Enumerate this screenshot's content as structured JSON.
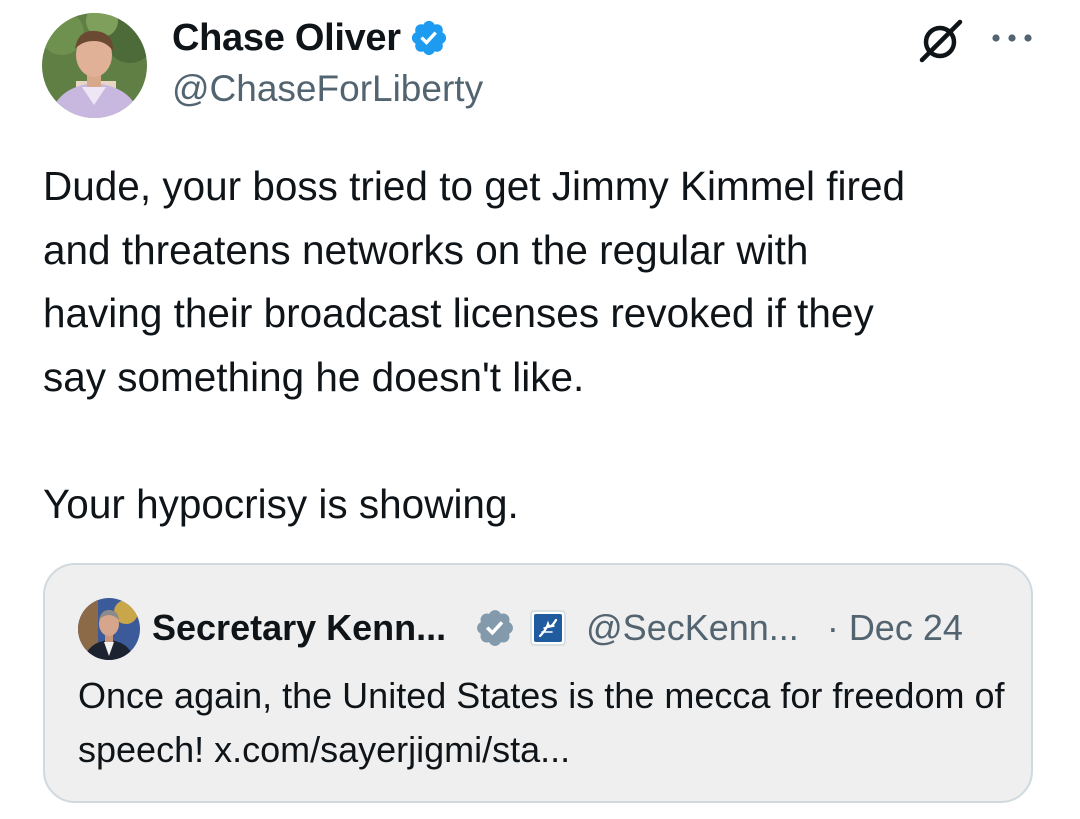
{
  "post": {
    "author": {
      "display_name": "Chase Oliver",
      "handle": "@ChaseForLiberty",
      "verified_icon": "verified-badge-icon",
      "verified_color": "#1d9bf0"
    },
    "header_icons": {
      "grok": "grok-icon",
      "more": "more-options-icon"
    },
    "text": "Dude, your boss tried to get Jimmy Kimmel fired\nand threatens networks on the regular with\nhaving their broadcast licenses revoked if they\nsay something he doesn't like.\n\nYour hypocrisy is showing."
  },
  "quote": {
    "author": {
      "display_name": "Secretary Kenn...",
      "handle": "@SecKenn...",
      "verified_icon": "government-verified-badge-icon",
      "verified_color": "#829aab",
      "affiliation_icon": "hhs-affiliation-icon"
    },
    "separator": "·",
    "date": "Dec 24",
    "text": "Once again, the United States is the mecca for freedom of speech! x.com/sayerjigmi/sta..."
  },
  "colors": {
    "primary_text": "#0f1419",
    "secondary_text": "#536471",
    "quote_background": "#efefef",
    "quote_border": "#cfd9de"
  }
}
